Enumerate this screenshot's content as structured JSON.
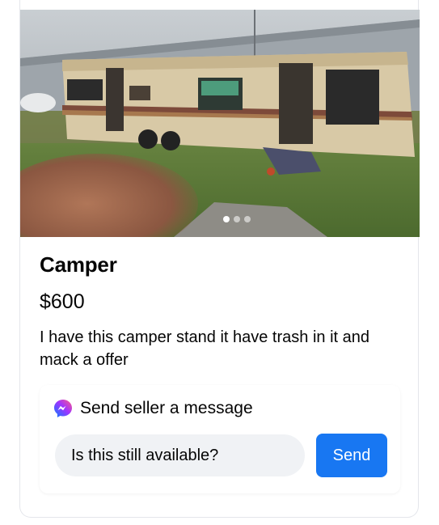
{
  "listing": {
    "title": "Camper",
    "price": "$600",
    "description": "I have this camper stand it have trash in it and mack a offer",
    "photo_count": 3,
    "active_photo_index": 0
  },
  "message": {
    "heading": "Send seller a message",
    "input_value": "Is this still available?",
    "send_label": "Send",
    "icon": "messenger-icon"
  },
  "colors": {
    "accent": "#1877f2",
    "input_bg": "#f0f2f5",
    "text": "#050505"
  }
}
